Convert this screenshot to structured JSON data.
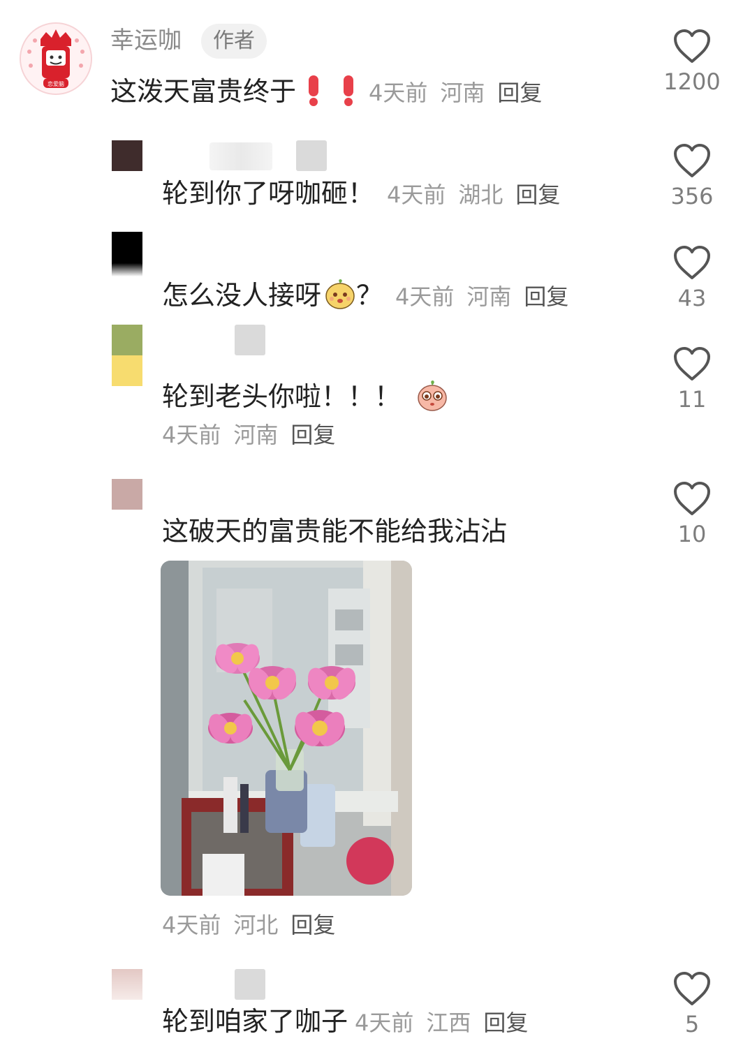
{
  "author_comment": {
    "username": "幸运咖",
    "badge": "作者",
    "text": "这泼天富贵终于",
    "time": "4天前",
    "location": "河南",
    "reply_label": "回复",
    "likes": "1200"
  },
  "replies": [
    {
      "text": "轮到你了呀咖砸！",
      "time": "4天前",
      "location": "湖北",
      "reply_label": "回复",
      "likes": "356"
    },
    {
      "text": "怎么没人接呀",
      "text_suffix": "？",
      "time": "4天前",
      "location": "河南",
      "reply_label": "回复",
      "likes": "43"
    },
    {
      "text": "轮到老头你啦！！！",
      "time": "4天前",
      "location": "河南",
      "reply_label": "回复",
      "likes": "11"
    },
    {
      "text": "这破天的富贵能不能给我沾沾",
      "time": "4天前",
      "location": "河北",
      "reply_label": "回复",
      "likes": "10"
    },
    {
      "text": "轮到咱家了咖子",
      "time": "4天前",
      "location": "江西",
      "reply_label": "回复",
      "likes": "5"
    }
  ],
  "colors": {
    "like_outline": "#555555",
    "meta_gray": "#9a9a9a",
    "exclamation_red": "#e8404a"
  },
  "icons": [
    "heart-outline-icon",
    "exclamation-icon",
    "emoji-face-icon"
  ]
}
